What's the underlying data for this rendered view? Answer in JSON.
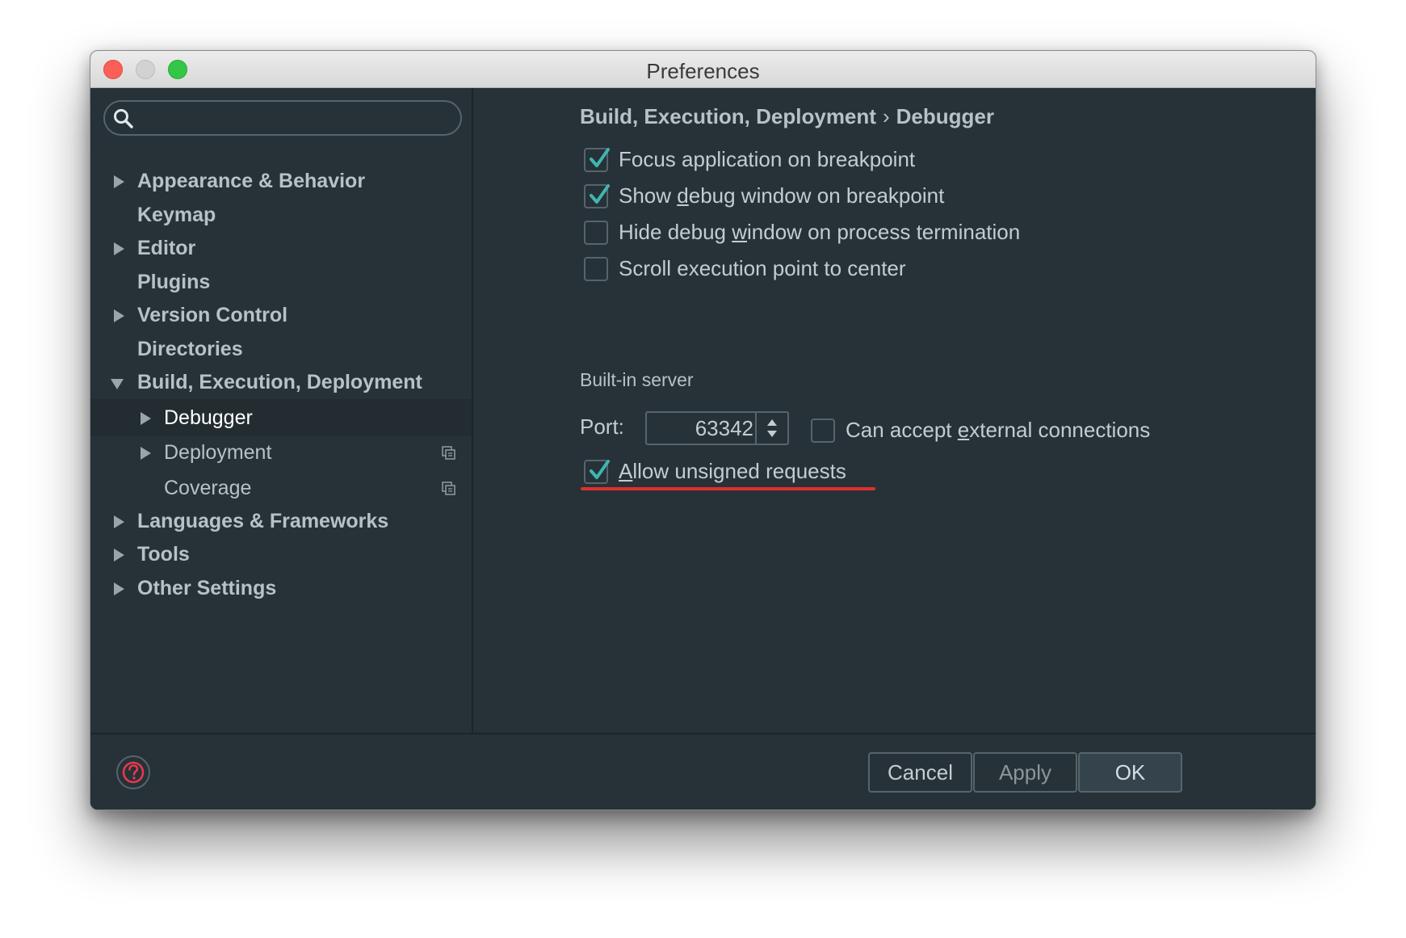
{
  "window": {
    "title": "Preferences"
  },
  "search": {
    "placeholder": "",
    "value": ""
  },
  "sidebar": {
    "items": [
      {
        "label": "Appearance & Behavior",
        "expandable": true
      },
      {
        "label": "Keymap",
        "expandable": false
      },
      {
        "label": "Editor",
        "expandable": true
      },
      {
        "label": "Plugins",
        "expandable": false
      },
      {
        "label": "Version Control",
        "expandable": true
      },
      {
        "label": "Directories",
        "expandable": false
      },
      {
        "label": "Build, Execution, Deployment",
        "expandable": true,
        "expanded": true
      },
      {
        "label": "Debugger",
        "expandable": true,
        "selected": true
      },
      {
        "label": "Deployment",
        "expandable": true
      },
      {
        "label": "Coverage",
        "expandable": false
      },
      {
        "label": "Languages & Frameworks",
        "expandable": true
      },
      {
        "label": "Tools",
        "expandable": true
      },
      {
        "label": "Other Settings",
        "expandable": true
      }
    ]
  },
  "breadcrumb": {
    "parent": "Build, Execution, Deployment",
    "separator": "›",
    "current": "Debugger"
  },
  "options": {
    "focus_app": {
      "label": "Focus application on breakpoint",
      "checked": true
    },
    "show_debug": {
      "label_pre": "Show ",
      "label_u": "d",
      "label_post": "ebug window on breakpoint",
      "checked": true
    },
    "hide_debug": {
      "label_pre": "Hide debug ",
      "label_u": "w",
      "label_post": "indow on process termination",
      "checked": false
    },
    "scroll_exec": {
      "label": "Scroll execution point to center",
      "checked": false
    }
  },
  "server": {
    "section_title": "Built-in server",
    "port_label": "Port:",
    "port_value": "63342",
    "external": {
      "label_pre": "Can accept ",
      "label_u": "e",
      "label_post": "xternal connections",
      "checked": false
    },
    "unsigned": {
      "label_u": "A",
      "label_post": "llow unsigned requests",
      "checked": true
    }
  },
  "footer": {
    "cancel": "Cancel",
    "apply": "Apply",
    "ok": "OK"
  },
  "colors": {
    "background": "#263238",
    "text": "#c4ccd0",
    "accent_check": "#3fb6b2",
    "highlight": "#e0302d"
  }
}
